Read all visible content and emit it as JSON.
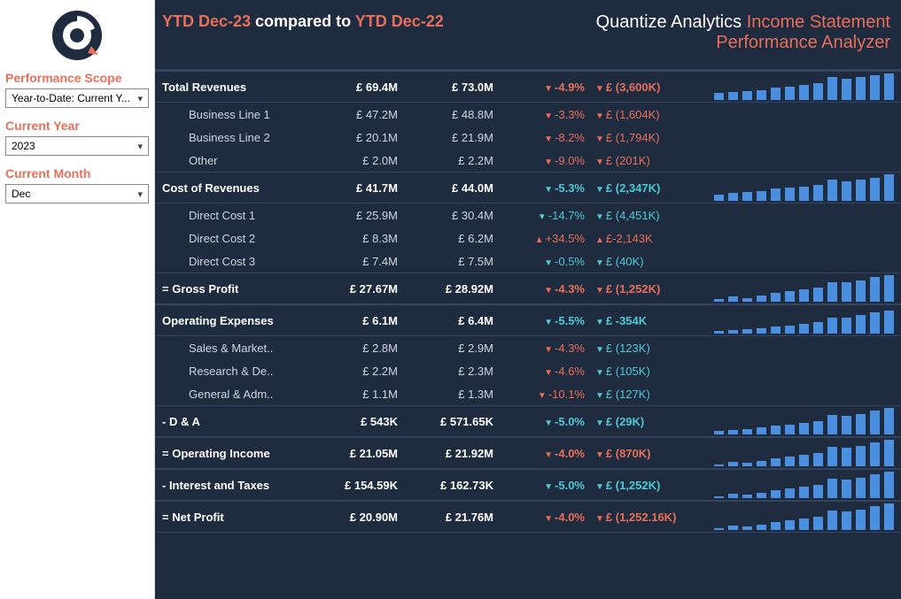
{
  "sidebar": {
    "scope_label": "Performance Scope",
    "scope_value": "Year-to-Date: Current Y...",
    "year_label": "Current Year",
    "year_value": "2023",
    "month_label": "Current Month",
    "month_value": "Dec"
  },
  "header": {
    "left_a": "YTD Dec-23",
    "left_mid": "  compared to ",
    "left_b": "YTD Dec-22",
    "right_a": "Quantize Analytics ",
    "right_b": "Income Statement",
    "right_c": "Performance Analyzer"
  },
  "rows": [
    {
      "type": "major",
      "name": "Total Revenues",
      "v1": "£ 69.4M",
      "v2": "£ 73.0M",
      "pct": "-4.9%",
      "pcls": "neg",
      "d": "£ (3,600K)",
      "dcls": "neg",
      "di": "d",
      "bars": [
        8,
        9,
        10,
        11,
        14,
        15,
        17,
        19,
        26,
        24,
        26,
        28,
        30
      ]
    },
    {
      "type": "sub",
      "name": "Business Line 1",
      "v1": "£ 47.2M",
      "v2": "£ 48.8M",
      "pct": "-3.3%",
      "pcls": "neg",
      "d": "£ (1,604K)",
      "dcls": "neg",
      "di": "d"
    },
    {
      "type": "sub",
      "name": "Business Line 2",
      "v1": "£ 20.1M",
      "v2": "£ 21.9M",
      "pct": "-8.2%",
      "pcls": "neg",
      "d": "£ (1,794K)",
      "dcls": "neg",
      "di": "d"
    },
    {
      "type": "sub",
      "name": "Other",
      "v1": "£ 2.0M",
      "v2": "£ 2.2M",
      "pct": "-9.0%",
      "pcls": "neg",
      "d": "£ (201K)",
      "dcls": "neg",
      "di": "d"
    },
    {
      "type": "major",
      "name": "Cost of Revenues",
      "v1": "£ 41.7M",
      "v2": "£ 44.0M",
      "pct": "-5.3%",
      "pcls": "pos",
      "d": "£ (2,347K)",
      "dcls": "pos",
      "di": "d",
      "bars": [
        7,
        9,
        10,
        11,
        14,
        15,
        16,
        18,
        24,
        22,
        24,
        26,
        30
      ]
    },
    {
      "type": "sub",
      "name": "Direct Cost 1",
      "v1": "£ 25.9M",
      "v2": "£ 30.4M",
      "pct": "-14.7%",
      "pcls": "pos",
      "d": "£ (4,451K)",
      "dcls": "pos",
      "di": "d"
    },
    {
      "type": "sub",
      "name": "Direct Cost 2",
      "v1": "£ 8.3M",
      "v2": "£ 6.2M",
      "pct": "+34.5%",
      "pcls": "neg",
      "d": "£-2,143K",
      "dcls": "neg",
      "di": "u"
    },
    {
      "type": "sub",
      "name": "Direct Cost 3",
      "v1": "£ 7.4M",
      "v2": "£ 7.5M",
      "pct": "-0.5%",
      "pcls": "pos",
      "d": "£ (40K)",
      "dcls": "pos",
      "di": "d"
    },
    {
      "type": "major",
      "name": "= Gross Profit",
      "v1": "£ 27.67M",
      "v2": "£ 28.92M",
      "pct": "-4.3%",
      "pcls": "neg",
      "d": "£ (1,252K)",
      "dcls": "neg",
      "di": "d",
      "bars": [
        3,
        6,
        4,
        7,
        10,
        12,
        14,
        16,
        22,
        22,
        24,
        28,
        30
      ]
    },
    {
      "type": "major",
      "name": "Operating Expenses",
      "v1": "£ 6.1M",
      "v2": "£ 6.4M",
      "pct": "-5.5%",
      "pcls": "pos",
      "d": "£ -354K",
      "dcls": "pos",
      "di": "d",
      "bars": [
        3,
        4,
        5,
        6,
        8,
        9,
        11,
        13,
        18,
        18,
        21,
        24,
        26
      ]
    },
    {
      "type": "sub",
      "name": "Sales & Market..",
      "v1": "£ 2.8M",
      "v2": "£ 2.9M",
      "pct": "-4.3%",
      "pcls": "neg",
      "d": "£ (123K)",
      "dcls": "pos",
      "di": "d"
    },
    {
      "type": "sub",
      "name": "Research & De..",
      "v1": "£ 2.2M",
      "v2": "£ 2.3M",
      "pct": "-4.6%",
      "pcls": "neg",
      "d": "£ (105K)",
      "dcls": "pos",
      "di": "d"
    },
    {
      "type": "sub",
      "name": "General & Adm..",
      "v1": "£ 1.1M",
      "v2": "£ 1.3M",
      "pct": "-10.1%",
      "pcls": "neg",
      "d": "£ (127K)",
      "dcls": "pos",
      "di": "d"
    },
    {
      "type": "major",
      "name": "- D & A",
      "v1": "£ 543K",
      "v2": "£ 571.65K",
      "pct": "-5.0%",
      "pcls": "pos",
      "d": "£ (29K)",
      "dcls": "pos",
      "di": "d",
      "bars": [
        4,
        5,
        6,
        8,
        10,
        11,
        13,
        15,
        22,
        21,
        23,
        27,
        30
      ]
    },
    {
      "type": "major",
      "name": "= Operating Income",
      "v1": "£ 21.05M",
      "v2": "£ 21.92M",
      "pct": "-4.0%",
      "pcls": "neg",
      "d": "£ (870K)",
      "dcls": "neg",
      "di": "d",
      "bars": [
        2,
        5,
        4,
        6,
        9,
        11,
        13,
        15,
        22,
        21,
        23,
        27,
        30
      ]
    },
    {
      "type": "major",
      "name": "- Interest and Taxes",
      "v1": "£ 154.59K",
      "v2": "£ 162.73K",
      "pct": "-5.0%",
      "pcls": "pos",
      "d": "£ (1,252K)",
      "dcls": "pos",
      "di": "d",
      "bars": [
        2,
        5,
        4,
        6,
        9,
        11,
        13,
        15,
        22,
        21,
        23,
        27,
        30
      ]
    },
    {
      "type": "major",
      "name": "= Net Profit",
      "v1": "£ 20.90M",
      "v2": "£ 21.76M",
      "pct": "-4.0%",
      "pcls": "neg",
      "d": "£ (1,252.16K)",
      "dcls": "neg",
      "di": "d",
      "bars": [
        2,
        5,
        4,
        6,
        9,
        11,
        13,
        15,
        22,
        21,
        23,
        27,
        30
      ]
    }
  ]
}
